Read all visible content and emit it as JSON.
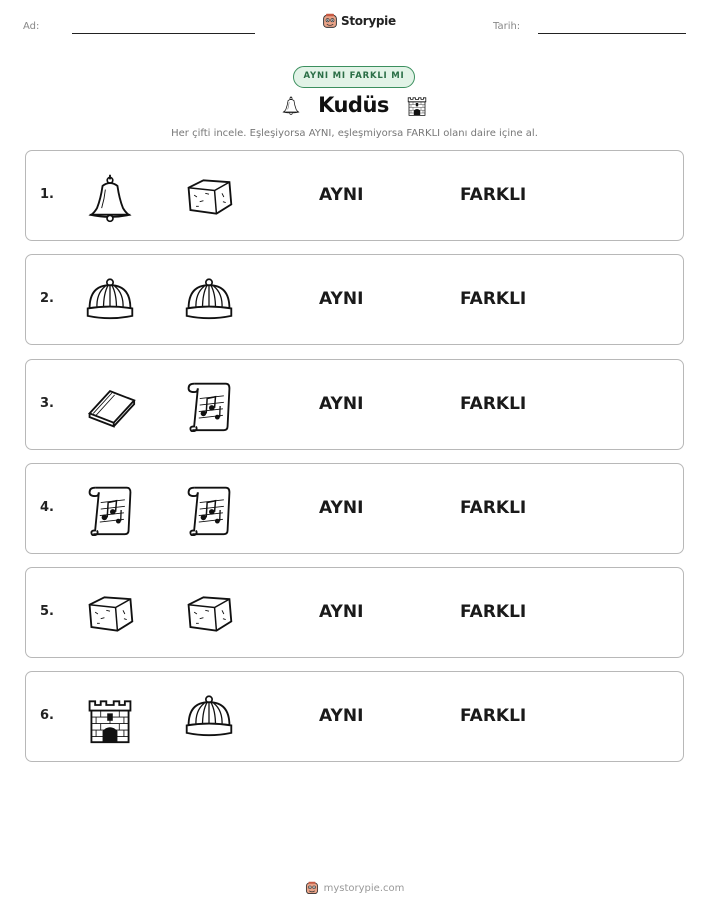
{
  "header": {
    "name_label": "Ad:",
    "date_label": "Tarih:",
    "brand": "Storypie",
    "brand_icon": "storypie-mascot-icon"
  },
  "badge": "AYNI MI FARKLI MI",
  "title": "Kudüs",
  "title_icons": [
    "bell-icon",
    "castle-icon"
  ],
  "instruction": "Her çifti incele. Eşleşiyorsa AYNI, eşleşmiyorsa FARKLI olanı daire içine al.",
  "rows": [
    {
      "number": "1.",
      "left": "bell",
      "right": "stone",
      "same_label": "AYNI",
      "diff_label": "FARKLI"
    },
    {
      "number": "2.",
      "left": "cap",
      "right": "cap",
      "same_label": "AYNI",
      "diff_label": "FARKLI"
    },
    {
      "number": "3.",
      "left": "book",
      "right": "scroll",
      "same_label": "AYNI",
      "diff_label": "FARKLI"
    },
    {
      "number": "4.",
      "left": "scroll",
      "right": "scroll",
      "same_label": "AYNI",
      "diff_label": "FARKLI"
    },
    {
      "number": "5.",
      "left": "stone",
      "right": "stone",
      "same_label": "AYNI",
      "diff_label": "FARKLI"
    },
    {
      "number": "6.",
      "left": "castle",
      "right": "cap",
      "same_label": "AYNI",
      "diff_label": "FARKLI"
    }
  ],
  "footer": {
    "text": "mystorypie.com",
    "icon": "storypie-mascot-icon"
  },
  "colors": {
    "badge_border": "#3b8f5e",
    "badge_fill": "#e2f3e7",
    "badge_text": "#2a6e46",
    "card_border": "#b8b8b8"
  }
}
